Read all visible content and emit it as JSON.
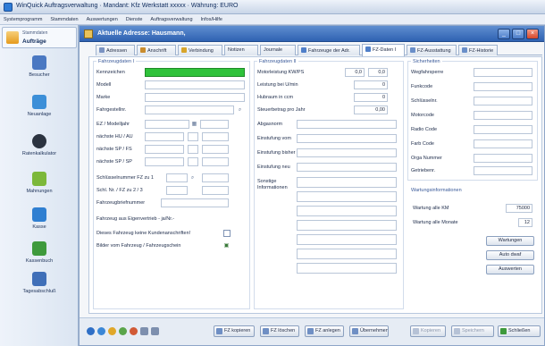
{
  "app": {
    "title": "WinQuick Auftragsverwaltung · Mandant: Kfz Werkstatt xxxxx · Währung: EURO"
  },
  "menu": [
    "Systemprogramm",
    "Stammdaten",
    "Auswertungen",
    "Dienste",
    "Auftragsverwaltung",
    "Infos/Hilfe"
  ],
  "sidebar": {
    "tab": {
      "caption": "Stammdaten",
      "label": "Aufträge"
    },
    "items": [
      {
        "label": "Besucher",
        "icon": "document-icon",
        "color": "#4a78c2"
      },
      {
        "label": "Neuanlage",
        "icon": "document-add-icon",
        "color": "#3c8fd8"
      },
      {
        "label": "Ratenkalkulator",
        "icon": "disc-icon",
        "color": "#2b3340"
      },
      {
        "label": "Mahnungen",
        "icon": "folder-icon",
        "color": "#7cb83a"
      },
      {
        "label": "Kasse",
        "icon": "cash-icon",
        "color": "#2f7fd1"
      },
      {
        "label": "Kassenbuch",
        "icon": "book-icon",
        "color": "#3e9a3c"
      },
      {
        "label": "Tagesabschluß",
        "icon": "calendar-icon",
        "color": "#3f6fb8"
      }
    ]
  },
  "child": {
    "title": "Aktuelle Adresse: Hausmann,",
    "tabs": [
      {
        "label": "Adressen",
        "color": "#7a93c2"
      },
      {
        "label": "Anschrift",
        "color": "#c98c2e"
      },
      {
        "label": "Verbindung",
        "color": "#d8a52b"
      },
      {
        "label": "Notizen",
        "color": "#8fa0bd"
      },
      {
        "label": "Journale",
        "color": "#8fa0bd"
      },
      {
        "label": "Fahrzeuge der Adr.",
        "color": "#4f7fc9"
      },
      {
        "label": "FZ-Daten I",
        "color": "#4f7fc9"
      },
      {
        "label": "FZ-Ausstattung",
        "color": "#6a8fc9"
      },
      {
        "label": "FZ-Historie",
        "color": "#6a8fc9"
      }
    ]
  },
  "groups": {
    "g1": "Fahrzeugdaten I",
    "g2": "Fahrzeugdaten II",
    "g3": "Sicherheiten",
    "g4": "Wartungsinformationen"
  },
  "col1": {
    "labels": [
      "Kennzeichen",
      "Modell",
      "Marke",
      "Fahrgestellnr.",
      "EZ / Modelljahr",
      "nächste HU / AU",
      "nächste SP / FS",
      "nächste SP / SP",
      "Schlüsselnummer FZ zu 1",
      "Schl. Nr. / FZ zu 2 / 3",
      "Fahrzeugbriefnummer",
      "Fahrzeug aus Eigenvertrieb  - ja/Nr.-",
      "Dieses Fahrzeug keine Kundenanschriften!",
      "Bilder vom Fahrzeug / Fahrzeugschein"
    ]
  },
  "col2": {
    "labels": [
      "Motorleistung KW/PS",
      "Leistung bei U/min",
      "Hubraum in ccm",
      "Steuerbetrag pro Jahr",
      "Abgasnorm",
      "Einstufung vom",
      "Einstufung bisher",
      "Einstufung neu",
      "Sonstige Informationen"
    ],
    "values": {
      "kw": "0,0",
      "ps": "0,0",
      "leistung": "0",
      "hubraum": "0",
      "steuer": "0,00"
    }
  },
  "col3": {
    "labels": [
      "Wegfahrsperre",
      "Funkcode",
      "Schlüsselnr.",
      "Motorcode",
      "Radio Code",
      "Farb Code",
      "Orga Nummer",
      "Getriebenr."
    ]
  },
  "wartung": {
    "km_label": "Wartung alle KM",
    "km_value": "75000",
    "monate_label": "Wartung alle Monate",
    "monate_value": "12"
  },
  "buttons": {
    "wartungen": "Wartungen",
    "auto_dxf": "Auto dwaf",
    "auswerten": "Auswerten"
  },
  "bottom": {
    "buttons": [
      "FZ kopieren",
      "FZ löschen",
      "FZ anlegen",
      "Übernehmen"
    ],
    "right": [
      "Kopieren",
      "Speichern",
      "Schließen"
    ]
  }
}
